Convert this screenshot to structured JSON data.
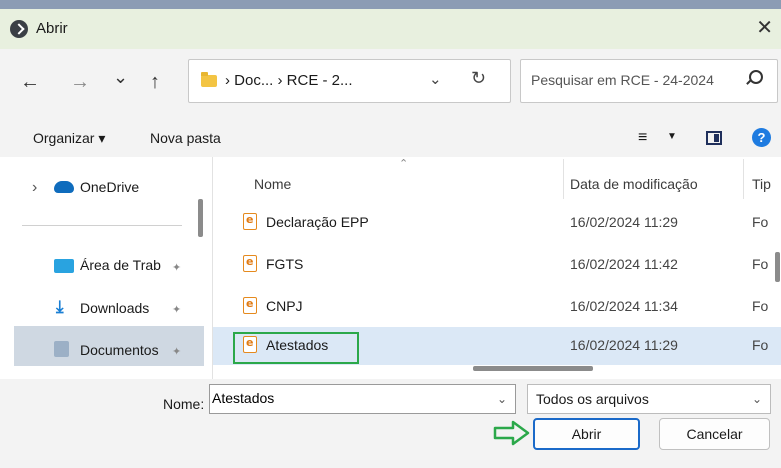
{
  "window": {
    "title": "Abrir",
    "close_glyph": "✕"
  },
  "nav_buttons": {
    "back": "←",
    "forward": "→",
    "recent": "⌄",
    "up": "↑"
  },
  "address": {
    "breadcrumb": "› Doc... › RCE - 2...",
    "dropdown_glyph": "⌄",
    "refresh_glyph": "↻"
  },
  "search": {
    "placeholder": "Pesquisar em RCE - 24-2024"
  },
  "toolbar": {
    "organize_label": "Organizar ▾",
    "new_folder_label": "Nova pasta",
    "view_glyph": "≡",
    "view_drop": "▼",
    "help_glyph": "?"
  },
  "sidebar": {
    "items": [
      {
        "label": "OneDrive",
        "chevron": "›"
      },
      {
        "label": "Área de Trab"
      },
      {
        "label": "Downloads"
      },
      {
        "label": "Documentos"
      }
    ],
    "pin_glyph": "✦"
  },
  "files": {
    "columns": {
      "name": "Nome",
      "modified": "Data de modificação",
      "type": "Tip"
    },
    "rows": [
      {
        "name": "Declaração EPP",
        "modified": "16/02/2024 11:29",
        "type": "Fo"
      },
      {
        "name": "FGTS",
        "modified": "16/02/2024 11:42",
        "type": "Fo"
      },
      {
        "name": "CNPJ",
        "modified": "16/02/2024 11:34",
        "type": "Fo"
      },
      {
        "name": "Atestados",
        "modified": "16/02/2024 11:29",
        "type": "Fo"
      }
    ],
    "selected": "Atestados"
  },
  "footer": {
    "name_label": "Nome:",
    "name_value": "Atestados",
    "file_type": "Todos os arquivos",
    "open_label": "Abrir",
    "cancel_label": "Cancelar"
  },
  "colors": {
    "highlight_green": "#2ba84a",
    "selection_blue": "#dbe8f6",
    "accent": "#1b6ac9"
  }
}
